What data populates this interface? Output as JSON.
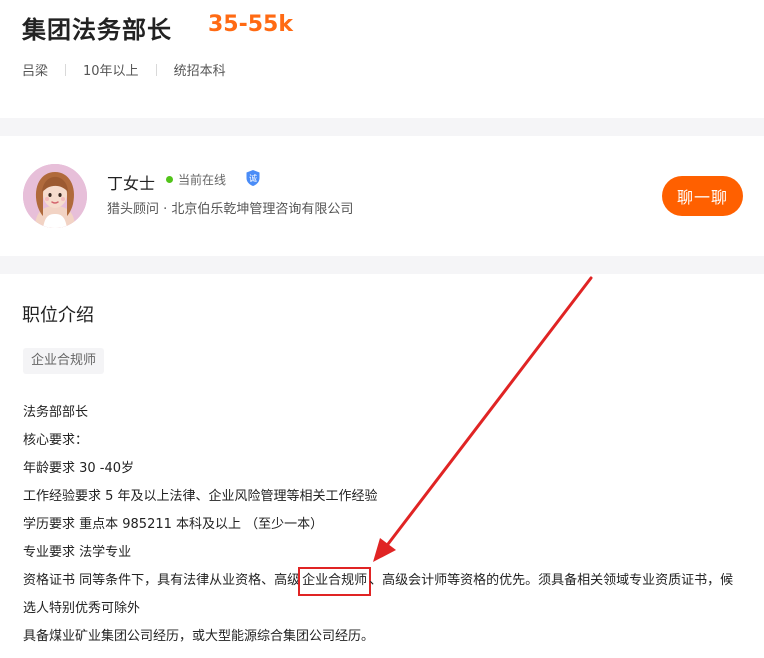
{
  "job": {
    "title": "集团法务部长",
    "salary": "35-55k",
    "tags": [
      "吕梁",
      "10年以上",
      "统招本科"
    ]
  },
  "recruiter": {
    "name": "丁女士",
    "status": "当前在线",
    "verified_badge": "诚",
    "subtitle": "猎头顾问 · 北京伯乐乾坤管理咨询有限公司",
    "chat_button": "聊一聊"
  },
  "description": {
    "section_title": "职位介绍",
    "keyword_tag": "企业合规师",
    "lines": [
      "法务部部长",
      "核心要求：",
      "年龄要求 30 -40岁",
      "工作经验要求 5 年及以上法律、企业风险管理等相关工作经验",
      "学历要求 重点本 985211 本科及以上 （至少一本）",
      "专业要求 法学专业"
    ],
    "cert_line": {
      "before": "资格证书 同等条件下，具有法律从业资格、高级",
      "highlight": "企业合规师",
      "after": "、高级会计师等资格的优先。须具备相关领域专业资质证书，候选人特别优秀可除外"
    },
    "last_line": "具备煤业矿业集团公司经历，或大型能源综合集团公司经历。"
  },
  "colors": {
    "salary": "#ff6a13",
    "chat_button": "#ff6000",
    "online": "#52c41a",
    "verified": "#4a8cf7",
    "annotation": "#e02424"
  },
  "icons": {
    "avatar": "avatar-illustration",
    "online": "online-dot-icon",
    "verified": "verified-shield-icon",
    "annotation": "red-arrow-annotation"
  }
}
